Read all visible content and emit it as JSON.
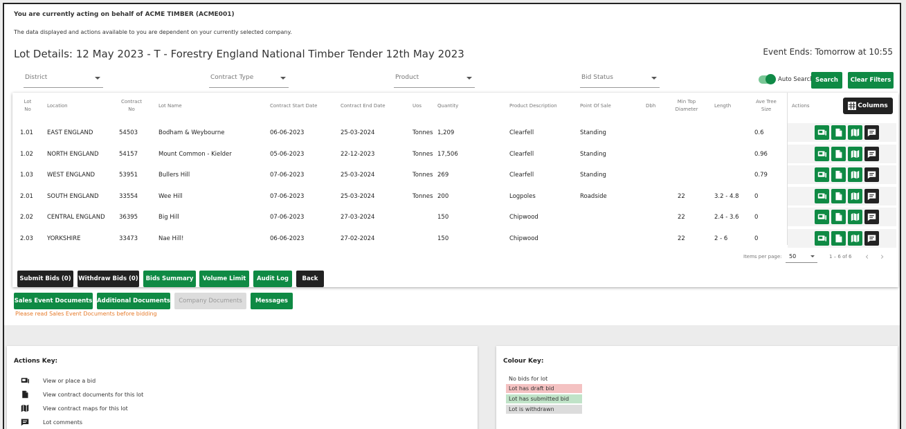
{
  "notice": {
    "title": "You are currently acting on behalf of ACME TIMBER (ACME001)",
    "text": "The data displayed and actions available to you are dependent on your currently selected company."
  },
  "page_title": "Lot Details: 12 May 2023 - T - Forestry England National Timber Tender 12th May 2023",
  "event_ends": "Event Ends: Tomorrow at 10:55",
  "filters": {
    "district": "District",
    "contract_type": "Contract Type",
    "product": "Product",
    "bid_status": "Bid Status"
  },
  "auto_search_label": "Auto Search",
  "auto_search_on": true,
  "search_label": "Search",
  "clear_filters_label": "Clear Filters",
  "columns_label": "Columns",
  "table": {
    "headers": {
      "lot_no": [
        "Lot",
        "No"
      ],
      "location": "Location",
      "contract_no": [
        "Contract",
        "No"
      ],
      "lot_name": "Lot Name",
      "start": "Contract Start Date",
      "end": "Contract End Date",
      "uos": "Uos",
      "quantity": "Quantity",
      "product": "Product Description",
      "pos": "Point Of Sale",
      "dbh": "Dbh",
      "min_top": [
        "Min Top",
        "Diameter"
      ],
      "length": "Length",
      "ave_tree": [
        "Ave Tree",
        "Size"
      ],
      "actions": "Actions"
    },
    "rows": [
      {
        "lot": "1.01",
        "location": "EAST ENGLAND",
        "contract": "54503",
        "name": "Bodham & Weybourne",
        "start": "06-06-2023",
        "end": "25-03-2024",
        "uos": "Tonnes",
        "qty": "1,209",
        "product": "Clearfell",
        "pos": "Standing",
        "dbh": "",
        "mintop": "",
        "length": "",
        "ave": "0.6"
      },
      {
        "lot": "1.02",
        "location": "NORTH ENGLAND",
        "contract": "54157",
        "name": "Mount Common - Kielder",
        "start": "05-06-2023",
        "end": "22-12-2023",
        "uos": "Tonnes",
        "qty": "17,506",
        "product": "Clearfell",
        "pos": "Standing",
        "dbh": "",
        "mintop": "",
        "length": "",
        "ave": "0.96"
      },
      {
        "lot": "1.03",
        "location": "WEST ENGLAND",
        "contract": "53951",
        "name": "Bullers Hill",
        "start": "07-06-2023",
        "end": "25-03-2024",
        "uos": "Tonnes",
        "qty": "269",
        "product": "Clearfell",
        "pos": "Standing",
        "dbh": "",
        "mintop": "",
        "length": "",
        "ave": "0.79"
      },
      {
        "lot": "2.01",
        "location": "SOUTH ENGLAND",
        "contract": "33554",
        "name": "Wee Hill",
        "start": "07-06-2023",
        "end": "25-03-2024",
        "uos": "Tonnes",
        "qty": "200",
        "product": "Logpoles",
        "pos": "Roadside",
        "dbh": "",
        "mintop": "22",
        "length": "3.2 - 4.8",
        "ave": "0"
      },
      {
        "lot": "2.02",
        "location": "CENTRAL ENGLAND",
        "contract": "36395",
        "name": "Big Hill",
        "start": "07-06-2023",
        "end": "27-03-2024",
        "uos": "",
        "qty": "150",
        "product": "Chipwood",
        "pos": "",
        "dbh": "",
        "mintop": "22",
        "length": "2.4 - 3.6",
        "ave": "0"
      },
      {
        "lot": "2.03",
        "location": "YORKSHIRE",
        "contract": "33473",
        "name": "Nae Hill!",
        "start": "06-06-2023",
        "end": "27-02-2024",
        "uos": "",
        "qty": "150",
        "product": "Chipwood",
        "pos": "",
        "dbh": "",
        "mintop": "22",
        "length": "2 - 6",
        "ave": "0"
      }
    ]
  },
  "pager": {
    "label": "Items per page:",
    "value": "50",
    "range": "1 – 6 of 6",
    "prev": "‹",
    "next": "›"
  },
  "action_buttons": {
    "submit_bids": "Submit Bids (0)",
    "withdraw_bids": "Withdraw Bids (0)",
    "bids_summary": "Bids Summary",
    "volume_limit": "Volume Limit",
    "audit_log": "Audit Log",
    "back": "Back"
  },
  "doc_buttons": {
    "sales_event": "Sales Event Documents",
    "additional": "Additional Documents",
    "company": "Company Documents",
    "messages": "Messages"
  },
  "warning": "Please read Sales Event Documents before bidding",
  "actions_key": {
    "title": "Actions Key:",
    "items": [
      {
        "icon": "view-bid-icon",
        "label": "View or place a bid"
      },
      {
        "icon": "document-icon",
        "label": "View contract documents for this lot"
      },
      {
        "icon": "map-icon",
        "label": "View contract maps for this lot"
      },
      {
        "icon": "comment-icon",
        "label": "Lot comments"
      }
    ]
  },
  "colour_key": {
    "title": "Colour Key:",
    "items": [
      {
        "label": "No bids for lot",
        "color": "#ffffff"
      },
      {
        "label": "Lot has draft bid",
        "color": "#f4c2c2"
      },
      {
        "label": "Lot has submitted bid",
        "color": "#c0e3c8"
      },
      {
        "label": "Lot is withdrawn",
        "color": "#dcdcdc"
      }
    ]
  },
  "colors": {
    "accent_green": "#0f8a44",
    "dark_button": "#222222",
    "warning": "#e67a2a"
  }
}
